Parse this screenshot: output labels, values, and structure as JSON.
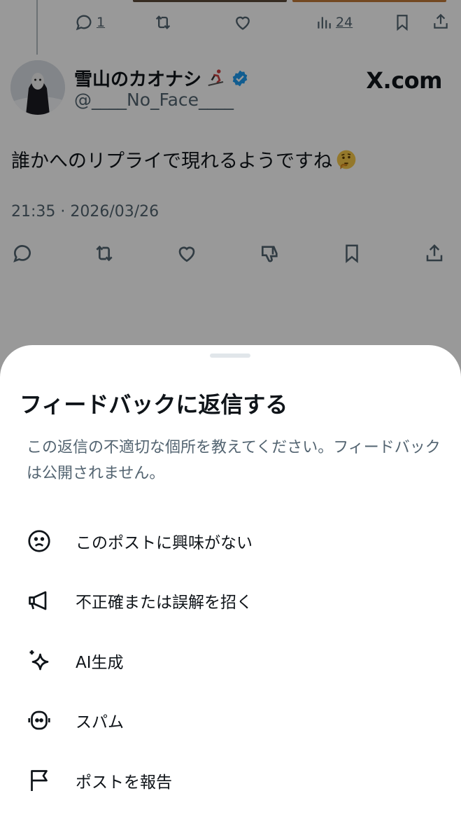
{
  "tweet": {
    "prev_actions": {
      "reply_count": "1",
      "views_count": "24"
    },
    "author": {
      "display_name": "雪山のカオナシ",
      "handle": "@____No_Face____"
    },
    "watermark": "X.com",
    "text": "誰かへのリプライで現れるようですね",
    "timestamp": "21:35 · 2026/03/26"
  },
  "sheet": {
    "title": "フィードバックに返信する",
    "description": "この返信の不適切な個所を教えてください。フィードバックは公開されません。",
    "items": [
      {
        "label": "このポストに興味がない",
        "icon": "frown-face-icon"
      },
      {
        "label": "不正確または誤解を招く",
        "icon": "megaphone-icon"
      },
      {
        "label": "AI生成",
        "icon": "sparkle-icon"
      },
      {
        "label": "スパム",
        "icon": "robot-icon"
      },
      {
        "label": "ポストを報告",
        "icon": "flag-icon"
      }
    ]
  },
  "colors": {
    "text": "#0f1419",
    "secondary": "#536471",
    "verified": "#1d9bf0",
    "overlay": "rgba(0,0,0,0.40)"
  }
}
